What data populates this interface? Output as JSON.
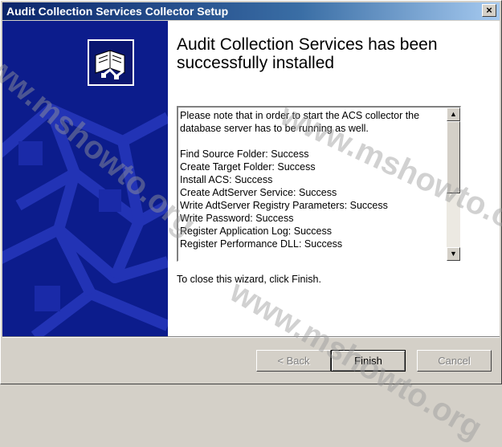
{
  "window": {
    "title": "Audit Collection Services Collector Setup",
    "close_label": "×"
  },
  "content": {
    "heading": "Audit Collection Services has been successfully installed",
    "log": {
      "note_line1": "Please note that in order to start the ACS collector the",
      "note_line2": "database server has to be running as well.",
      "items": [
        "Find Source Folder: Success",
        "Create Target Folder: Success",
        "Install ACS: Success",
        "Create AdtServer Service: Success",
        "Write AdtServer Registry Parameters: Success",
        "Write Password: Success",
        "Register Application Log: Success",
        "Register Performance DLL: Success"
      ]
    },
    "close_hint": "To close this wizard, click Finish."
  },
  "buttons": {
    "back": "< Back",
    "finish": "Finish",
    "cancel": "Cancel"
  },
  "icons": {
    "logo": "book-network-icon",
    "scroll_up": "scroll-up-arrow-icon",
    "scroll_down": "scroll-down-arrow-icon"
  },
  "watermark": {
    "text": "www.mshowto.org"
  },
  "colors": {
    "titlebar_start": "#0a246a",
    "titlebar_end": "#a6caf0",
    "side_panel": "#0c1c8c"
  }
}
